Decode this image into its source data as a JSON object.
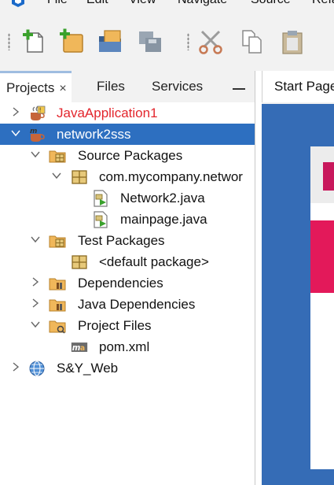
{
  "menu": {
    "items": [
      "File",
      "Edit",
      "View",
      "Navigate",
      "Source",
      "Refa"
    ]
  },
  "toolbar": {
    "buttons": [
      "new-file",
      "new-project",
      "open-project",
      "save-all",
      "cut",
      "copy",
      "paste"
    ]
  },
  "panel": {
    "tabs": [
      {
        "label": "Projects",
        "active": true
      },
      {
        "label": "Files",
        "active": false
      },
      {
        "label": "Services",
        "active": false
      }
    ],
    "close_glyph": "×",
    "minimize_glyph": "—"
  },
  "tree": [
    {
      "label": "JavaApplication1",
      "icon": "java-project-icon",
      "expanded": false,
      "state": "error"
    },
    {
      "label": "network2sss",
      "icon": "maven-project-icon",
      "expanded": true,
      "state": "selected"
    },
    {
      "label": "Source Packages",
      "icon": "package-folder-icon",
      "expanded": true
    },
    {
      "label": "com.mycompany.networ",
      "icon": "package-icon",
      "expanded": true
    },
    {
      "label": "Network2.java",
      "icon": "java-class-icon"
    },
    {
      "label": "mainpage.java",
      "icon": "java-class-icon"
    },
    {
      "label": "Test Packages",
      "icon": "package-folder-icon",
      "expanded": true
    },
    {
      "label": "<default package>",
      "icon": "package-icon"
    },
    {
      "label": "Dependencies",
      "icon": "library-folder-icon",
      "expanded": false
    },
    {
      "label": "Java Dependencies",
      "icon": "library-folder-icon",
      "expanded": false
    },
    {
      "label": "Project Files",
      "icon": "config-folder-icon",
      "expanded": true
    },
    {
      "label": "pom.xml",
      "icon": "maven-file-icon"
    },
    {
      "label": "S&Y_Web",
      "icon": "web-project-icon",
      "expanded": false
    }
  ],
  "editor": {
    "tab_label": "Start Page"
  },
  "colors": {
    "selection": "#2d6fc0",
    "error_text": "#e3262d",
    "accent_tab": "#9fbde0",
    "start_page_bg": "#356cb6"
  }
}
